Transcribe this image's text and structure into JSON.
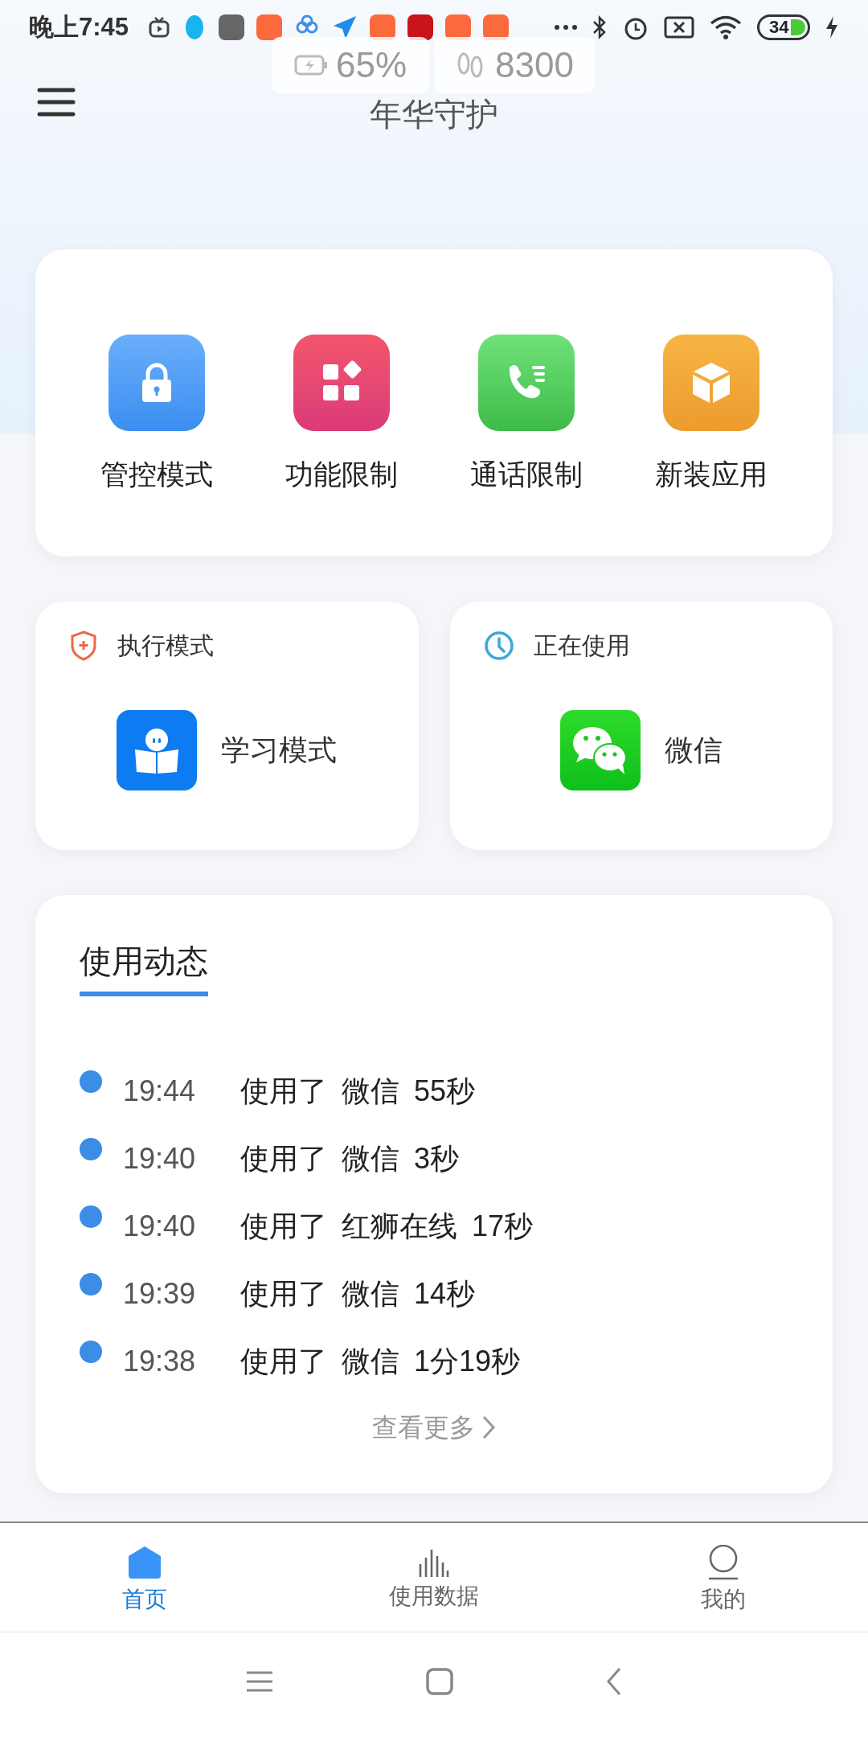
{
  "status_bar": {
    "time": "晚上7:45",
    "battery": "34"
  },
  "overlay": {
    "battery": "65%",
    "steps": "8300"
  },
  "header": {
    "title": "年华守护"
  },
  "quick_actions": [
    {
      "label": "管控模式",
      "kind": "lock"
    },
    {
      "label": "功能限制",
      "kind": "apps"
    },
    {
      "label": "通话限制",
      "kind": "call"
    },
    {
      "label": "新装应用",
      "kind": "box"
    }
  ],
  "info_cards": [
    {
      "title": "执行模式",
      "kind": "mode",
      "app": {
        "name": "学习模式",
        "kind": "study"
      }
    },
    {
      "title": "正在使用",
      "kind": "usage",
      "app": {
        "name": "微信",
        "kind": "chat"
      }
    }
  ],
  "activity": {
    "title": "使用动态",
    "more": "查看更多",
    "items": [
      {
        "time": "19:44",
        "verb": "使用了",
        "app": "微信",
        "duration": "55秒"
      },
      {
        "time": "19:40",
        "verb": "使用了",
        "app": "微信",
        "duration": "3秒"
      },
      {
        "time": "19:40",
        "verb": "使用了",
        "app": "红狮在线",
        "duration": "17秒"
      },
      {
        "time": "19:39",
        "verb": "使用了",
        "app": "微信",
        "duration": "14秒"
      },
      {
        "time": "19:38",
        "verb": "使用了",
        "app": "微信",
        "duration": "1分19秒"
      }
    ]
  },
  "tabs": [
    {
      "label": "首页",
      "kind": "home",
      "selected": true
    },
    {
      "label": "使用数据",
      "kind": "data",
      "selected": false
    },
    {
      "label": "我的",
      "kind": "me",
      "selected": false
    }
  ]
}
